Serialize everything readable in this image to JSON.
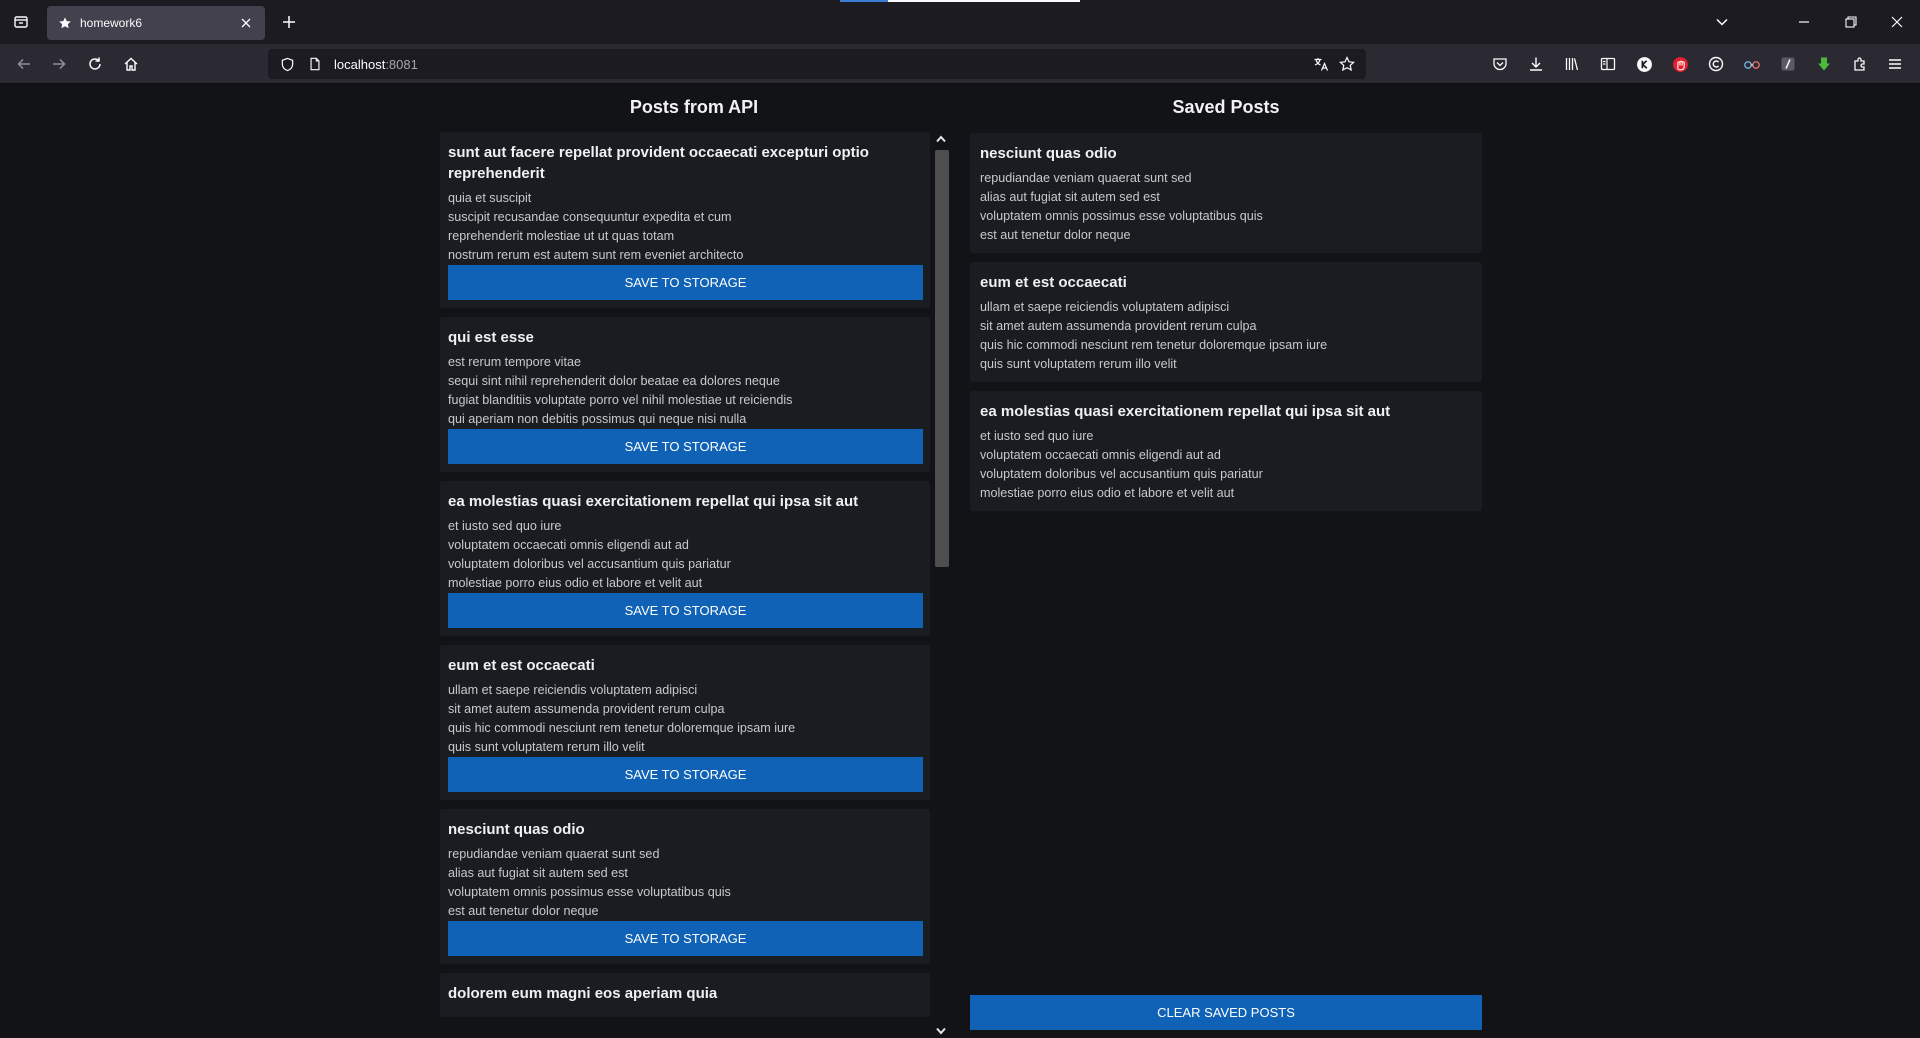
{
  "browser": {
    "tab_title": "homework6",
    "url_host": "localhost",
    "url_port": ":8081"
  },
  "api_column": {
    "title": "Posts from API",
    "save_label": "SAVE TO STORAGE",
    "scroll_fraction": 0.48,
    "posts": [
      {
        "title": "sunt aut facere repellat provident occaecati excepturi optio reprehenderit",
        "body": "quia et suscipit\nsuscipit recusandae consequuntur expedita et cum\nreprehenderit molestiae ut ut quas totam\nnostrum rerum est autem sunt rem eveniet architecto"
      },
      {
        "title": "qui est esse",
        "body": "est rerum tempore vitae\nsequi sint nihil reprehenderit dolor beatae ea dolores neque\nfugiat blanditiis voluptate porro vel nihil molestiae ut reiciendis\nqui aperiam non debitis possimus qui neque nisi nulla"
      },
      {
        "title": "ea molestias quasi exercitationem repellat qui ipsa sit aut",
        "body": "et iusto sed quo iure\nvoluptatem occaecati omnis eligendi aut ad\nvoluptatem doloribus vel accusantium quis pariatur\nmolestiae porro eius odio et labore et velit aut"
      },
      {
        "title": "eum et est occaecati",
        "body": "ullam et saepe reiciendis voluptatem adipisci\nsit amet autem assumenda provident rerum culpa\nquis hic commodi nesciunt rem tenetur doloremque ipsam iure\nquis sunt voluptatem rerum illo velit"
      },
      {
        "title": "nesciunt quas odio",
        "body": "repudiandae veniam quaerat sunt sed\nalias aut fugiat sit autem sed est\nvoluptatem omnis possimus esse voluptatibus quis\nest aut tenetur dolor neque"
      },
      {
        "title": "dolorem eum magni eos aperiam quia",
        "body": ""
      }
    ]
  },
  "saved_column": {
    "title": "Saved Posts",
    "clear_label": "CLEAR SAVED POSTS",
    "posts": [
      {
        "title": "nesciunt quas odio",
        "body": "repudiandae veniam quaerat sunt sed\nalias aut fugiat sit autem sed est\nvoluptatem omnis possimus esse voluptatibus quis\nest aut tenetur dolor neque"
      },
      {
        "title": "eum et est occaecati",
        "body": "ullam et saepe reiciendis voluptatem adipisci\nsit amet autem assumenda provident rerum culpa\nquis hic commodi nesciunt rem tenetur doloremque ipsam iure\nquis sunt voluptatem rerum illo velit"
      },
      {
        "title": "ea molestias quasi exercitationem repellat qui ipsa sit aut",
        "body": "et iusto sed quo iure\nvoluptatem occaecati omnis eligendi aut ad\nvoluptatem doloribus vel accusantium quis pariatur\nmolestiae porro eius odio et labore et velit aut"
      }
    ]
  }
}
